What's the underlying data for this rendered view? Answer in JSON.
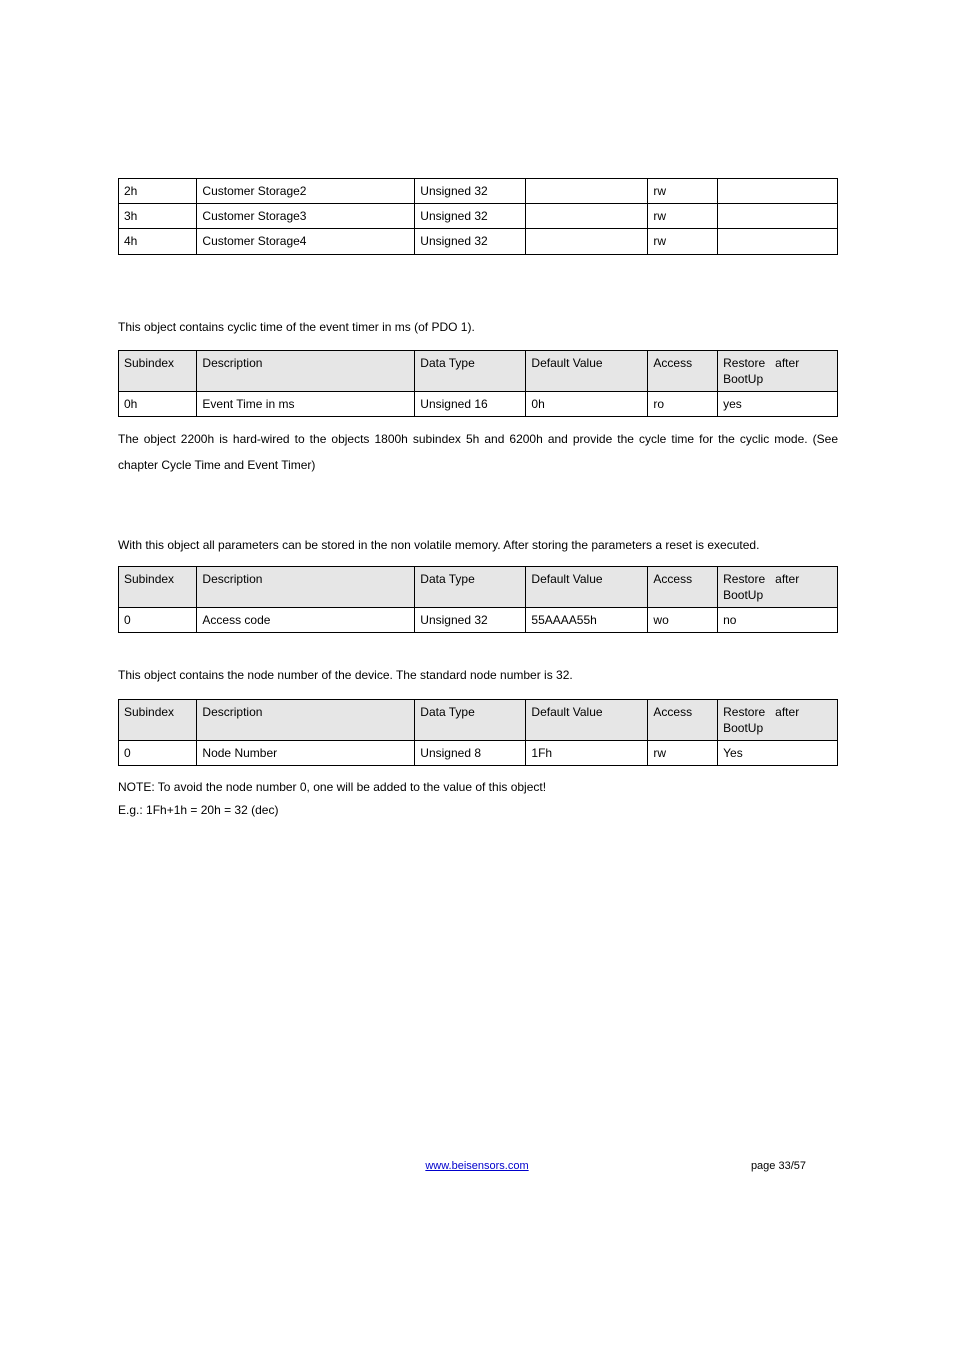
{
  "table1": {
    "rows": [
      {
        "sub": "2h",
        "desc": "Customer Storage2",
        "type": "Unsigned 32",
        "def": "",
        "acc": "rw",
        "rest": ""
      },
      {
        "sub": "3h",
        "desc": "Customer Storage3",
        "type": "Unsigned 32",
        "def": "",
        "acc": "rw",
        "rest": ""
      },
      {
        "sub": "4h",
        "desc": "Customer Storage4",
        "type": "Unsigned 32",
        "def": "",
        "acc": "rw",
        "rest": ""
      }
    ]
  },
  "para1": "This object contains cyclic time of the event timer in ms (of PDO 1).",
  "headers": {
    "sub": "Subindex",
    "desc": "Description",
    "type": "Data Type",
    "def": "Default Value",
    "acc": "Access",
    "rest1": "Restore",
    "rest2": "after",
    "rest3": "BootUp"
  },
  "table2": {
    "row": {
      "sub": "0h",
      "desc": "Event Time in ms",
      "type": "Unsigned 16",
      "def": "0h",
      "acc": "ro",
      "rest": "yes"
    }
  },
  "para2": "The object 2200h is hard-wired to the objects 1800h subindex 5h and 6200h and provide the cycle time for the cyclic mode. (See chapter Cycle Time and Event Timer)",
  "para3": "With this object all parameters can be stored in the non volatile memory. After storing the parameters a reset is executed.",
  "table3": {
    "row": {
      "sub": "0",
      "desc": "Access code",
      "type": "Unsigned 32",
      "def": "55AAAA55h",
      "acc": "wo",
      "rest": "no"
    }
  },
  "para4": "This object contains the node number of the device. The standard node number is 32.",
  "table4": {
    "row": {
      "sub": "0",
      "desc": "Node Number",
      "type": "Unsigned 8",
      "def": "1Fh",
      "acc": "rw",
      "rest": "Yes"
    }
  },
  "note1": "NOTE: To avoid the node number 0, one will be added to the value of this object!",
  "note2": "E.g.: 1Fh+1h = 20h = 32 (dec)",
  "footer": {
    "link": "www.beisensors.com",
    "page": "page 33/57"
  },
  "chart_data": [
    {
      "type": "table",
      "rows": [
        {
          "Subindex": "2h",
          "Description": "Customer Storage2",
          "Data Type": "Unsigned 32",
          "Default Value": "",
          "Access": "rw",
          "Restore after BootUp": ""
        },
        {
          "Subindex": "3h",
          "Description": "Customer Storage3",
          "Data Type": "Unsigned 32",
          "Default Value": "",
          "Access": "rw",
          "Restore after BootUp": ""
        },
        {
          "Subindex": "4h",
          "Description": "Customer Storage4",
          "Data Type": "Unsigned 32",
          "Default Value": "",
          "Access": "rw",
          "Restore after BootUp": ""
        }
      ]
    },
    {
      "type": "table",
      "columns": [
        "Subindex",
        "Description",
        "Data Type",
        "Default Value",
        "Access",
        "Restore after BootUp"
      ],
      "rows": [
        {
          "Subindex": "0h",
          "Description": "Event Time in ms",
          "Data Type": "Unsigned 16",
          "Default Value": "0h",
          "Access": "ro",
          "Restore after BootUp": "yes"
        }
      ]
    },
    {
      "type": "table",
      "columns": [
        "Subindex",
        "Description",
        "Data Type",
        "Default Value",
        "Access",
        "Restore after BootUp"
      ],
      "rows": [
        {
          "Subindex": "0",
          "Description": "Access code",
          "Data Type": "Unsigned 32",
          "Default Value": "55AAAA55h",
          "Access": "wo",
          "Restore after BootUp": "no"
        }
      ]
    },
    {
      "type": "table",
      "columns": [
        "Subindex",
        "Description",
        "Data Type",
        "Default Value",
        "Access",
        "Restore after BootUp"
      ],
      "rows": [
        {
          "Subindex": "0",
          "Description": "Node Number",
          "Data Type": "Unsigned 8",
          "Default Value": "1Fh",
          "Access": "rw",
          "Restore after BootUp": "Yes"
        }
      ]
    }
  ]
}
